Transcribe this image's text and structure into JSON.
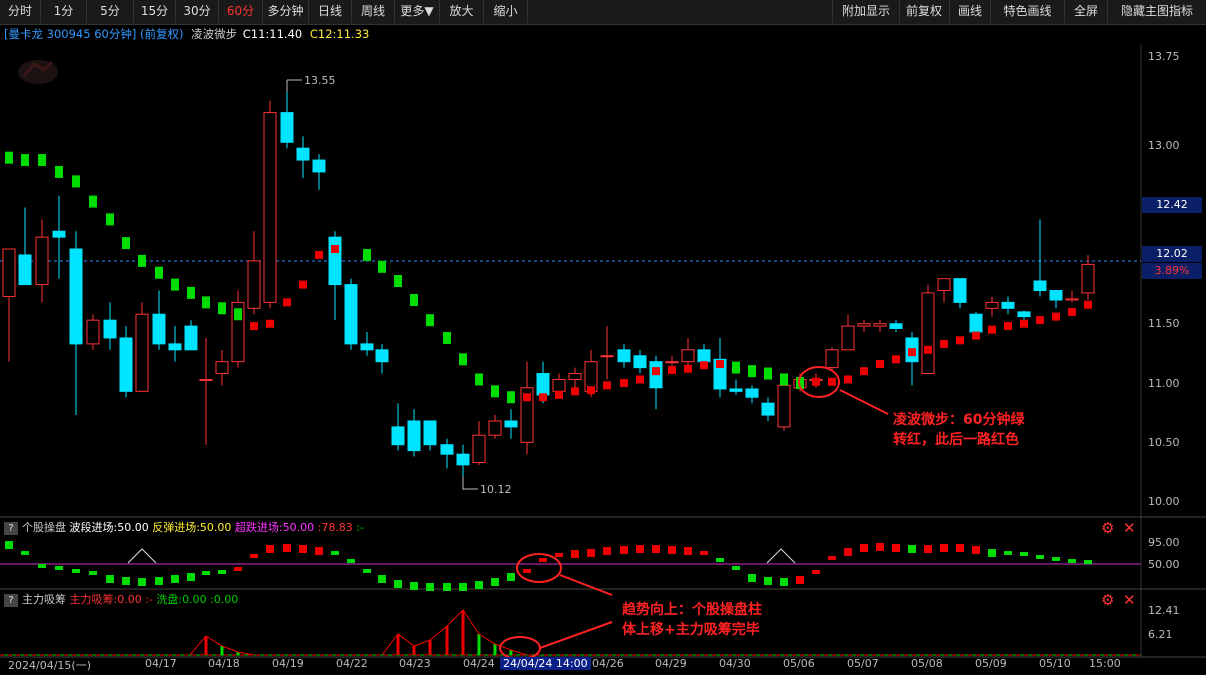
{
  "toolbar": {
    "left": [
      "分时",
      "1分",
      "5分",
      "15分",
      "30分",
      "60分",
      "多分钟",
      "日线",
      "周线",
      "更多▼",
      "放大",
      "缩小"
    ],
    "active": "60分",
    "right": [
      "附加显示",
      "前复权",
      "画线",
      "特色画线",
      "全屏",
      "隐藏主图指标"
    ]
  },
  "info": {
    "stock": "[曼卡龙 300945 60分钟] (前复权)",
    "indicator": "凌波微步",
    "c11": "C11:11.40",
    "c12": "C12:11.33"
  },
  "price_axis": {
    "ticks": [
      "13.75",
      "13.00",
      "12.50",
      "12.00",
      "11.50",
      "11.00",
      "10.50",
      "10.00"
    ],
    "tag1": "12.42",
    "tag2": "12.02",
    "tag3": "3.89%"
  },
  "annotations_price": {
    "high": "13.55",
    "low": "10.12"
  },
  "panel2": {
    "q": "?",
    "name": "个股操盘",
    "a": "波段进场:50.00",
    "b": "反弹进场:50.00",
    "c": "超跌进场:50.00",
    "d": ":78.83",
    "e": ":-",
    "ticks": [
      "95.00",
      "50.00"
    ]
  },
  "panel3": {
    "q": "?",
    "name": "主力吸筹",
    "a": "主力吸筹:0.00",
    "b": ":-",
    "c": "洗盘:0.00",
    "d": ":0.00",
    "ticks": [
      "12.41",
      "6.21"
    ]
  },
  "dates": [
    "2024/04/15(一)",
    "04/17",
    "04/18",
    "04/19",
    "04/22",
    "04/23",
    "04/24",
    "24/04/24 14:00",
    "04/26",
    "04/29",
    "04/30",
    "05/06",
    "05/07",
    "05/08",
    "05/09",
    "05/10",
    "15:00"
  ],
  "notes": {
    "n1a": "凌波微步：60分钟绿",
    "n1b": "转红，此后一路红色",
    "n2a": "趋势向上：个股操盘柱",
    "n2b": "体上移+主力吸筹完毕"
  },
  "colors": {
    "up": "#ff3333",
    "down": "#00e5ff",
    "bg": "#000000",
    "green": "#00cc00",
    "red": "#ee0000"
  }
}
